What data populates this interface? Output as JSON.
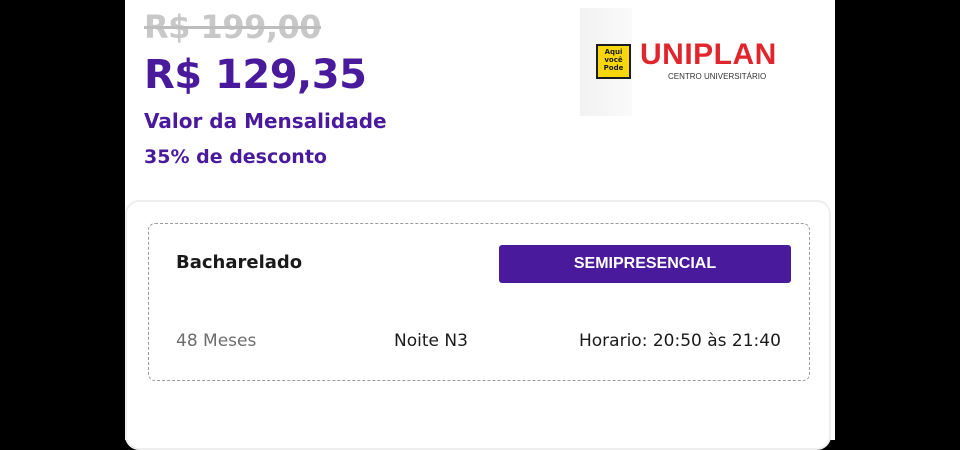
{
  "pricing": {
    "original_price": "R$ 199,00",
    "current_price": "R$ 129,35",
    "label": "Valor da Mensalidade",
    "discount": "35% de desconto"
  },
  "logo": {
    "badge_lines": [
      "Aqui",
      "você",
      "Pode"
    ],
    "name": "UNIPLAN",
    "subtitle": "CENTRO UNIVERSITÁRIO"
  },
  "course": {
    "degree": "Bacharelado",
    "modality": "SEMIPRESENCIAL",
    "duration": "48 Meses",
    "shift": "Noite N3",
    "schedule": "Horario: 20:50 às 21:40"
  },
  "colors": {
    "accent": "#4a1a9c",
    "logo_red": "#e0262c",
    "logo_yellow": "#f7d70b"
  }
}
